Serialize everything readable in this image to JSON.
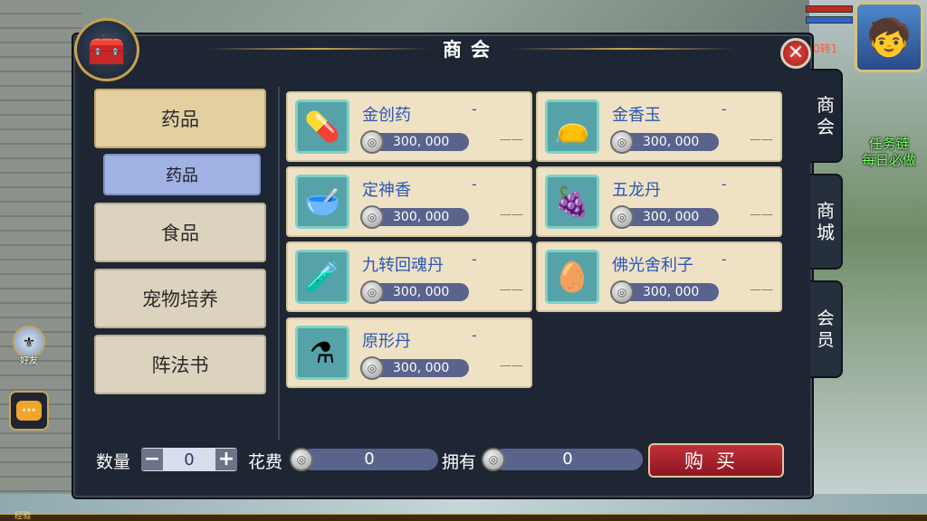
{
  "shop": {
    "title": "商会",
    "close_side_label": "0转1"
  },
  "side_tabs": [
    {
      "label": "商\n会",
      "active": true
    },
    {
      "label": "商\n城",
      "active": false
    },
    {
      "label": "会员",
      "active": false
    }
  ],
  "categories": [
    {
      "label": "药品",
      "active": true
    },
    {
      "label": "食品",
      "active": false
    },
    {
      "label": "宠物培养",
      "active": false
    },
    {
      "label": "阵法书",
      "active": false
    }
  ],
  "subcategory": {
    "label": "药品"
  },
  "items": [
    {
      "name": "金创药",
      "dash": "-",
      "price": "300, 000",
      "extra": "——",
      "icon": "medicine-box-icon"
    },
    {
      "name": "金香玉",
      "dash": "-",
      "price": "300, 000",
      "extra": "——",
      "icon": "red-pouch-icon"
    },
    {
      "name": "定神香",
      "dash": "-",
      "price": "300, 000",
      "extra": "——",
      "icon": "incense-bowl-icon"
    },
    {
      "name": "五龙丹",
      "dash": "-",
      "price": "300, 000",
      "extra": "——",
      "icon": "five-dragon-pill-icon"
    },
    {
      "name": "九转回魂丹",
      "dash": "-",
      "price": "300, 000",
      "extra": "——",
      "icon": "potion-bottle-icon"
    },
    {
      "name": "佛光舍利子",
      "dash": "-",
      "price": "300, 000",
      "extra": "——",
      "icon": "relic-box-icon"
    },
    {
      "name": "原形丹",
      "dash": "-",
      "price": "300, 000",
      "extra": "——",
      "icon": "blue-flask-icon"
    }
  ],
  "purchase": {
    "qty_label": "数量",
    "qty_value": "0",
    "minus": "−",
    "plus": "+",
    "cost_label": "花费",
    "cost_value": "0",
    "own_label": "拥有",
    "own_value": "0",
    "buy_label": "购买"
  },
  "hud": {
    "quest_line1": "任务链",
    "quest_line2": "每日必做",
    "friend_label": "好友",
    "exp_label": "经验"
  }
}
